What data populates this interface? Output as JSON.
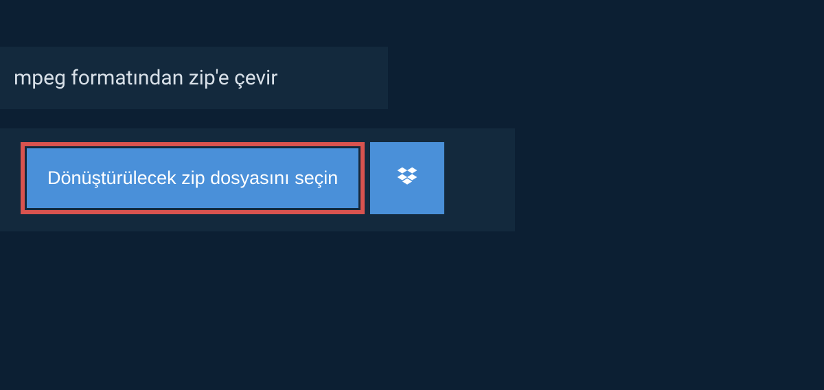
{
  "header": {
    "title": "mpeg formatından zip'e çevir"
  },
  "main": {
    "file_select_label": "Dönüştürülecek zip dosyasını seçin"
  },
  "colors": {
    "page_bg": "#0c1f33",
    "panel_bg": "#13293d",
    "button_bg": "#4a90d9",
    "highlight_border": "#d9534f",
    "text_light": "#d8e0e8",
    "text_white": "#ffffff"
  }
}
